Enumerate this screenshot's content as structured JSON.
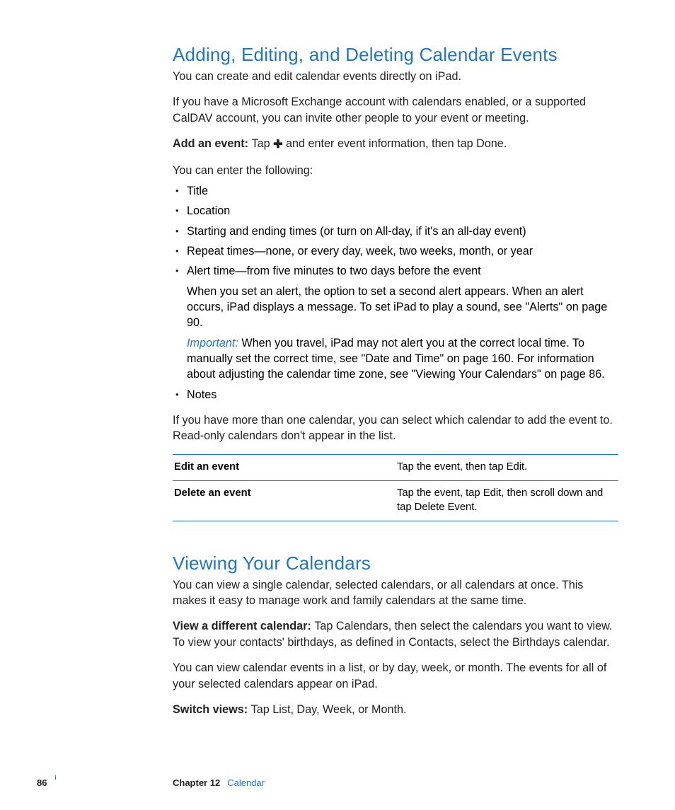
{
  "section1": {
    "title": "Adding, Editing, and Deleting Calendar Events",
    "p1": "You can create and edit calendar events directly on iPad.",
    "p2": "If you have a Microsoft Exchange account with calendars enabled, or a supported CalDAV account, you can invite other people to your event or meeting.",
    "add_label": "Add an event:  ",
    "add_pre": "Tap ",
    "add_post": " and enter event information, then tap Done.",
    "enter_intro": "You can enter the following:",
    "bullets": {
      "b0": "Title",
      "b1": "Location",
      "b2": "Starting and ending times (or turn on All-day, if it's an all-day event)",
      "b3": "Repeat times—none, or every day, week, two weeks, month, or year",
      "b4": "Alert time—from five minutes to two days before the event",
      "b4_sub1": "When you set an alert, the option to set a second alert appears. When an alert occurs, iPad displays a message. To set iPad to play a sound, see \"Alerts\" on page 90.",
      "b4_imp_label": "Important:  ",
      "b4_imp_text": "When you travel, iPad may not alert you at the correct local time. To manually set the correct time, see \"Date and Time\" on page 160. For information about adjusting the calendar time zone, see \"Viewing Your Calendars\" on page 86.",
      "b5": "Notes"
    },
    "p3": "If you have more than one calendar, you can select which calendar to add the event to. Read-only calendars don't appear in the list.",
    "table": {
      "r0": {
        "left": "Edit an event",
        "right": "Tap the event, then tap Edit."
      },
      "r1": {
        "left": "Delete an event",
        "right": "Tap the event, tap Edit, then scroll down and tap Delete Event."
      }
    }
  },
  "section2": {
    "title": "Viewing Your Calendars",
    "p1": "You can view a single calendar, selected calendars, or all calendars at once. This makes it easy to manage work and family calendars at the same time.",
    "view_label": "View a different calendar:  ",
    "view_text": "Tap Calendars, then select the calendars you want to view. To view your contacts' birthdays, as defined in Contacts, select the Birthdays calendar.",
    "p2": "You can view calendar events in a list, or by day, week, or month. The events for all of your selected calendars appear on iPad.",
    "switch_label": "Switch views:  ",
    "switch_text": "Tap List, Day, Week, or Month."
  },
  "footer": {
    "page": "86",
    "chapter_label": "Chapter 12",
    "chapter_name": "Calendar"
  }
}
